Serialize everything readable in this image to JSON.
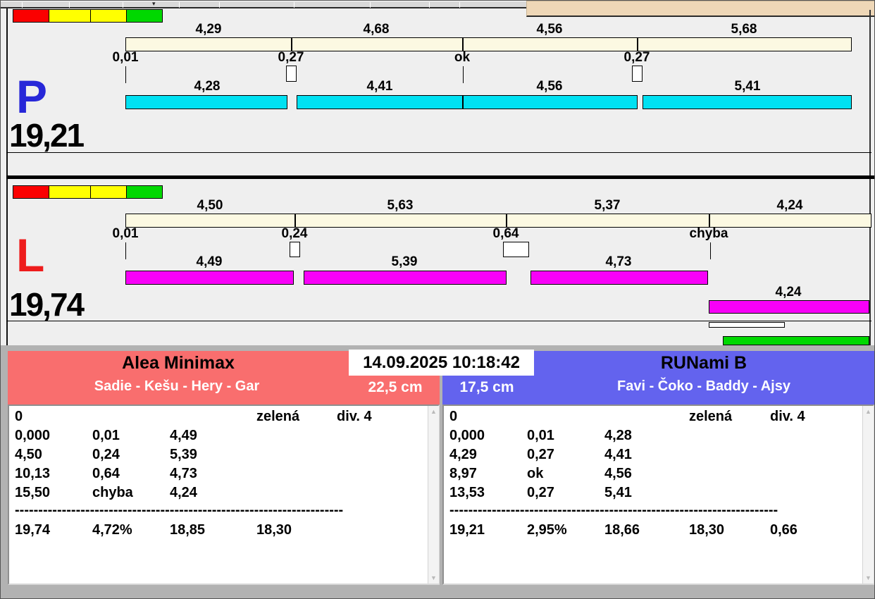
{
  "app": {
    "timestamp": "14.09.2025 10:18:42"
  },
  "colors": {
    "panel_bg": "#efefef",
    "accent_strip": "#eed7b7",
    "cream_bar": "#fcf9e2",
    "cyan_bar": "#00e1f2",
    "magenta_bar": "#f800f8",
    "green_bar": "#00d800",
    "traffic_red": "#fb0000",
    "traffic_yellow": "#ffff00",
    "traffic_green": "#00d800",
    "p_letter_color": "#2727d8",
    "l_letter_color": "#ee1c1c",
    "left_header": "#f96e6e",
    "right_header": "#6363ee",
    "gray_band": "#b2b2b2"
  },
  "lane_p": {
    "letter": "P",
    "total": "19,21",
    "top_segments": [
      "4,29",
      "4,68",
      "4,56",
      "5,68"
    ],
    "markers": [
      "0,01",
      "0,27",
      "ok",
      "0,27"
    ],
    "bottom_segments": [
      "4,28",
      "4,41",
      "4,56",
      "5,41"
    ]
  },
  "lane_l": {
    "letter": "L",
    "total": "19,74",
    "top_segments": [
      "4,50",
      "5,63",
      "5,37",
      "4,24"
    ],
    "markers": [
      "0,01",
      "0,24",
      "0,64",
      "chyba"
    ],
    "bottom_segments": [
      "4,49",
      "5,39",
      "4,73"
    ],
    "offset_segment": "4,24"
  },
  "left_card": {
    "title": "Alea Minimax",
    "subtitle": "Sadie - Kešu - Hery - Gar",
    "jump_height": "22,5 cm",
    "list": {
      "header": {
        "c0": "0",
        "c3": "zelená",
        "c4": "div. 4"
      },
      "rows": [
        {
          "c0": "0,000",
          "c1": "0,01",
          "c2": "4,49"
        },
        {
          "c0": "4,50",
          "c1": "0,24",
          "c2": "5,39"
        },
        {
          "c0": "10,13",
          "c1": "0,64",
          "c2": "4,73"
        },
        {
          "c0": "15,50",
          "c1": "chyba",
          "c2": "4,24"
        }
      ],
      "separator": "----------------------------------------------------------------------",
      "totals": {
        "c0": "19,74",
        "c1": "4,72%",
        "c2": "18,85",
        "c3": "18,30"
      }
    }
  },
  "right_card": {
    "title": "RUNami B",
    "subtitle": "Favi - Čoko - Baddy - Ajsy",
    "jump_height": "17,5 cm",
    "list": {
      "header": {
        "c0": "0",
        "c3": "zelená",
        "c4": "div. 4"
      },
      "rows": [
        {
          "c0": "0,000",
          "c1": "0,01",
          "c2": "4,28"
        },
        {
          "c0": "4,29",
          "c1": "0,27",
          "c2": "4,41"
        },
        {
          "c0": "8,97",
          "c1": "ok",
          "c2": "4,56"
        },
        {
          "c0": "13,53",
          "c1": "0,27",
          "c2": "5,41"
        }
      ],
      "separator": "----------------------------------------------------------------------",
      "totals": {
        "c0": "19,21",
        "c1": "2,95%",
        "c2": "18,66",
        "c3": "18,30",
        "c4": "0,66"
      }
    }
  }
}
